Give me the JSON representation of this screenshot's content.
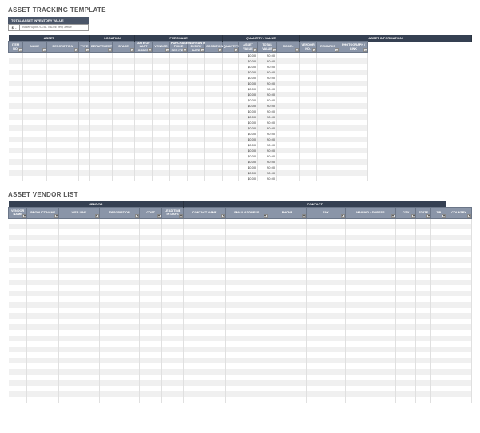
{
  "section1": {
    "title": "ASSET TRACKING TEMPLATE",
    "inv_label": "TOTAL ASSET INVENTORY VALUE",
    "inv_value": "$",
    "inv_tail": "-",
    "inv_note": "*Based upon TOTAL VALUE field, below",
    "groups": [
      {
        "label": "ASSET",
        "span": 4
      },
      {
        "label": "LOCATION",
        "span": 2
      },
      {
        "label": "PURCHASE",
        "span": 5
      },
      {
        "label": "QUANTITY / VALUE",
        "span": 4
      },
      {
        "label": "ASSET INFORMATION",
        "span": 4
      }
    ],
    "cols": [
      "ITEM NO.",
      "NAME",
      "DESCRIPTION",
      "TYPE",
      "DEPARTMENT",
      "SPACE",
      "DATE OF LAST ORDER",
      "VENDOR",
      "PURCHASE PRICE PER ITEM",
      "WARRANTY EXPIRY DATE",
      "CONDITION",
      "QUANTITY",
      "ASSET VALUE",
      "TOTAL VALUE",
      "MODEL",
      "VENDOR NO.",
      "REMARKS",
      "PHOTOGRAPH / LINK"
    ],
    "widths": [
      18,
      30,
      40,
      14,
      28,
      28,
      22,
      22,
      22,
      22,
      22,
      20,
      24,
      24,
      28,
      22,
      28,
      36
    ],
    "row_count": 23,
    "money_cols": [
      12,
      13
    ],
    "money_val": "$0.00"
  },
  "section2": {
    "title": "ASSET VENDOR LIST",
    "groups": [
      {
        "label": "VENDOR",
        "span": 6
      },
      {
        "label": "CONTACT",
        "span": 8
      }
    ],
    "cols": [
      "VENDOR NAME",
      "PRODUCT NAME",
      "WEB LINK",
      "DESCRIPTION",
      "COST",
      "LEAD TIME IN DAYS",
      "CONTACT NAME",
      "EMAIL ADDRESS",
      "PHONE",
      "FAX",
      "MAILING ADDRESS",
      "CITY",
      "STATE",
      "ZIP",
      "COUNTRY"
    ],
    "widths": [
      22,
      38,
      48,
      48,
      26,
      26,
      50,
      50,
      46,
      46,
      60,
      24,
      18,
      18,
      30
    ],
    "row_count": 33
  }
}
